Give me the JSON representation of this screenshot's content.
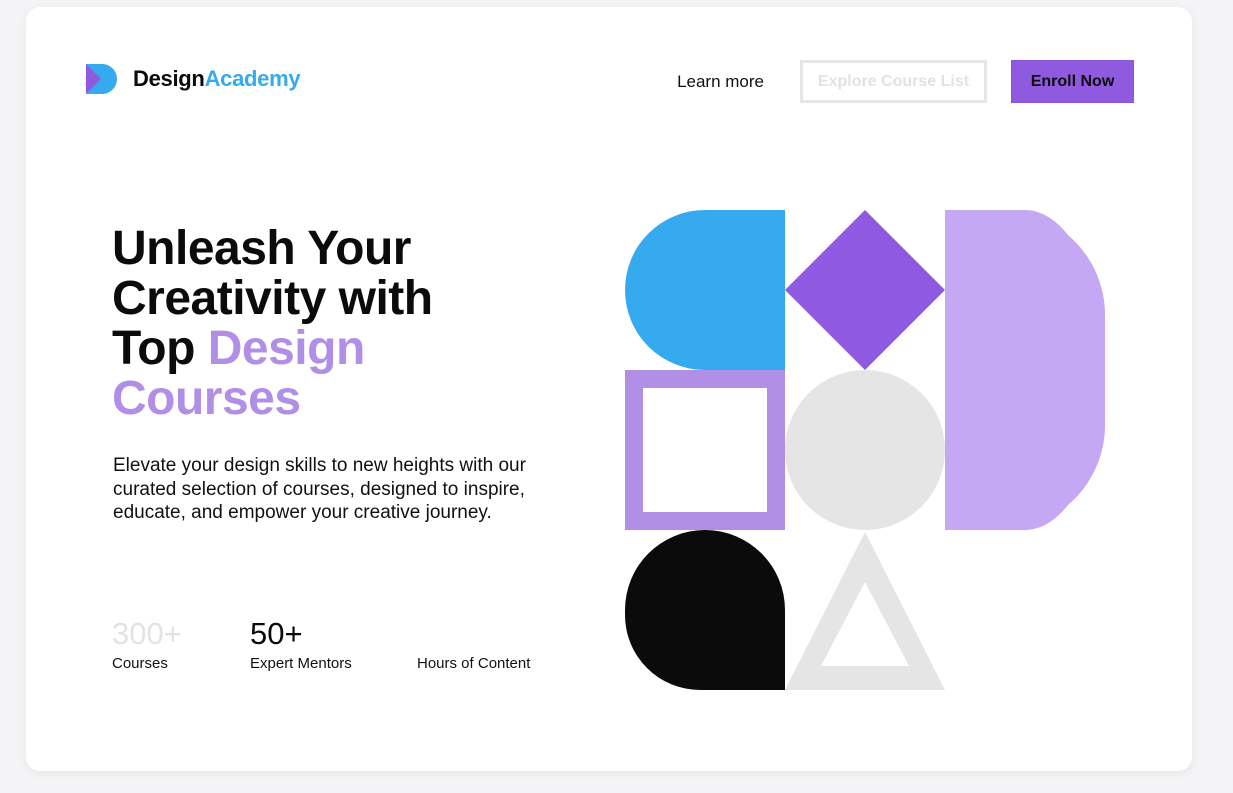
{
  "header": {
    "brand_part1": "Design",
    "brand_part2": "Academy",
    "nav": {
      "learn_more": "Learn more",
      "explore": "Explore Course List",
      "enroll": "Enroll Now"
    }
  },
  "hero": {
    "headline_line1": "Unleash Your",
    "headline_line2": "Creativity with",
    "headline_line3_plain": "Top",
    "headline_line3_accent": "Design",
    "headline_line4_accent": "Courses",
    "description": "Elevate your design skills to new heights with our curated selection of courses, designed to inspire, educate, and empower your creative journey."
  },
  "stats": [
    {
      "value": "300+",
      "label": "Courses"
    },
    {
      "value": "50+",
      "label": "Expert Mentors"
    },
    {
      "value": "",
      "label": "Hours of Content"
    }
  ],
  "colors": {
    "brand_blue": "#36aaee",
    "brand_purple": "#8f5ae0",
    "lavender": "#b18fe6",
    "light_lavender": "#c4a8f3",
    "light_gray": "#e5e5e5",
    "black": "#0b0b0b"
  },
  "icons": {
    "logo": "play-d-logo-icon"
  }
}
